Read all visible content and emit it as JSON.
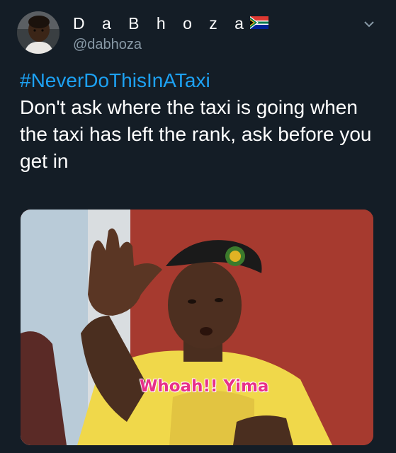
{
  "tweet": {
    "display_name": "D a B h o z a",
    "handle": "@dabhoza",
    "hashtag": "#NeverDoThisInATaxi",
    "body": "Don't ask where the taxi is going when the taxi has left the rank, ask before you get in"
  },
  "media": {
    "caption": "Whoah!! Yima"
  },
  "icons": {
    "flag": "south-africa-flag-icon",
    "menu": "chevron-down-icon",
    "avatar": "profile-photo"
  },
  "colors": {
    "background": "#141d26",
    "hashtag": "#1da1f2",
    "handle": "#8899a6",
    "caption": "#e8308a"
  }
}
